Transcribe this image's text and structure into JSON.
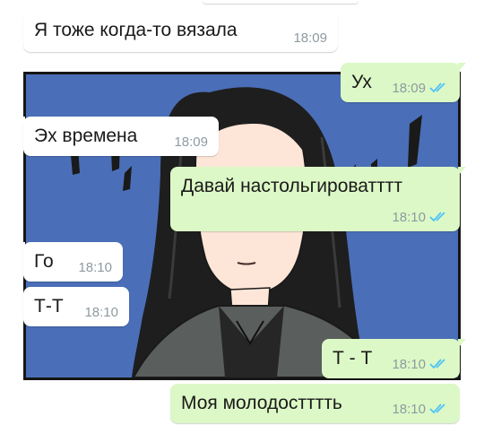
{
  "colors": {
    "incoming_bg": "#ffffff",
    "outgoing_bg": "#dcf8c6",
    "time_text": "#8e9aa0",
    "read_ticks": "#4fc3f7",
    "panel_bg": "#4a6fb8"
  },
  "messages": [
    {
      "direction": "in",
      "text": "Я тоже когда-то вязала",
      "time": "18:09"
    },
    {
      "direction": "out",
      "text": "Ух",
      "time": "18:09",
      "status": "read"
    },
    {
      "direction": "in",
      "text": "Эх времена",
      "time": "18:09"
    },
    {
      "direction": "out",
      "text": "Давай настольгироватттт",
      "time": "18:10",
      "status": "read"
    },
    {
      "direction": "in",
      "text": "Го",
      "time": "18:10"
    },
    {
      "direction": "in",
      "text": "Т-Т",
      "time": "18:10"
    },
    {
      "direction": "out",
      "text": "Т - Т",
      "time": "18:10",
      "status": "read"
    },
    {
      "direction": "out",
      "text": "Моя молодостттть",
      "time": "18:10",
      "status": "read"
    }
  ],
  "background_image": {
    "icon": "manga-girl-illustration"
  }
}
